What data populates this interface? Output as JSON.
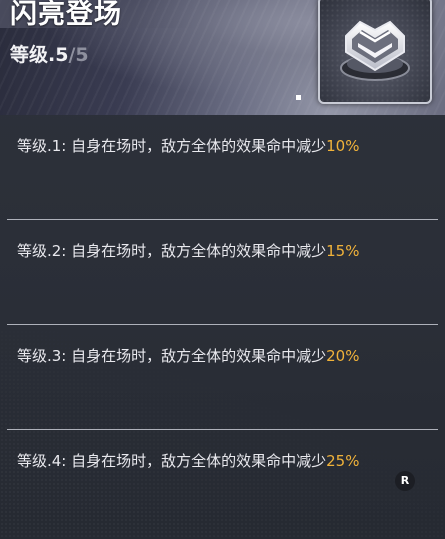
{
  "skill": {
    "title": "闪亮登场",
    "level_label": "等级.5",
    "level_max": "/5"
  },
  "levels": [
    {
      "prefix": "等级.1: 自身在场时，敌方全体的效果命中减少",
      "value": "10%"
    },
    {
      "prefix": "等级.2: 自身在场时，敌方全体的效果命中减少",
      "value": "15%"
    },
    {
      "prefix": "等级.3: 自身在场时，敌方全体的效果命中减少",
      "value": "20%"
    },
    {
      "prefix": "等级.4: 自身在场时，敌方全体的效果命中减少",
      "value": "25%"
    }
  ],
  "badge": {
    "label": "R"
  },
  "colors": {
    "highlight": "#f0b23a",
    "text": "#e9e9ee",
    "background": "#2b2f38"
  },
  "icons": {
    "skill_icon": "chevron-crest-icon"
  }
}
